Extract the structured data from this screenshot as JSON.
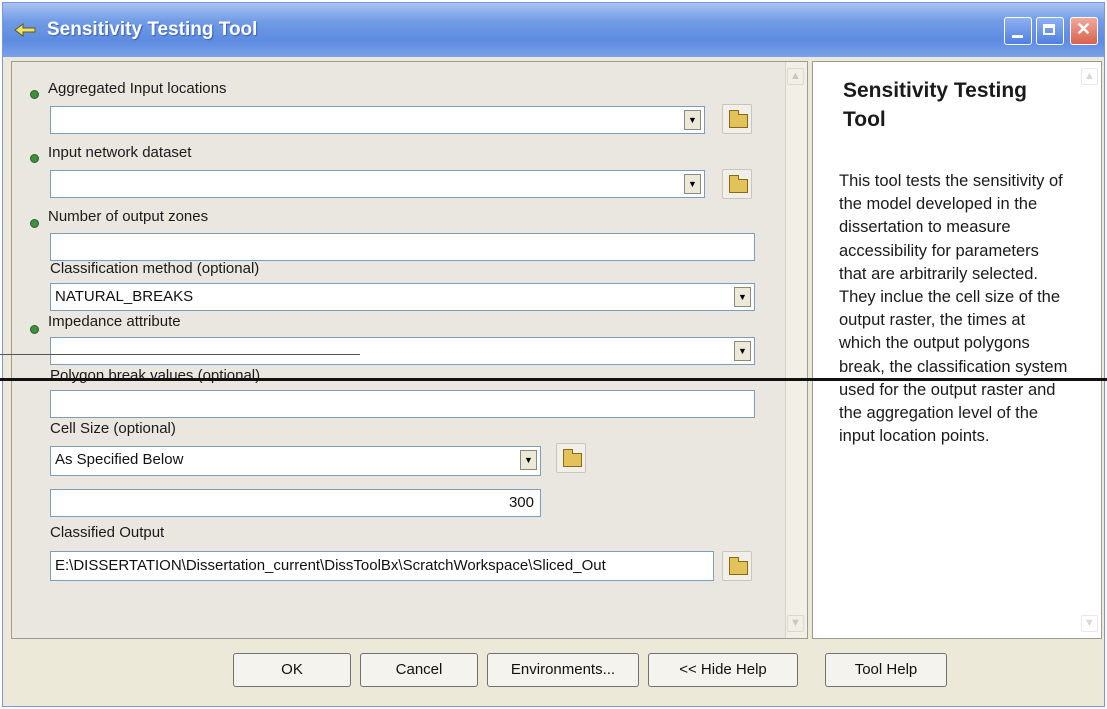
{
  "window": {
    "title": "Sensitivity Testing Tool"
  },
  "form": {
    "aggregated_input_label": "Aggregated Input locations",
    "aggregated_input_value": "",
    "network_label": "Input network dataset",
    "network_value": "",
    "zones_label": "Number of output zones",
    "zones_value": "",
    "classification_label": "Classification method (optional)",
    "classification_value": "NATURAL_BREAKS",
    "impedance_label": "Impedance attribute",
    "impedance_value": "",
    "polygon_label": "Polygon break values (optional)",
    "polygon_value": "",
    "cellsize_label": "Cell Size (optional)",
    "cellsize_value": "As Specified Below",
    "cellsize_number": "300",
    "output_label": "Classified Output",
    "output_value": "E:\\DISSERTATION\\Dissertation_current\\DissToolBx\\ScratchWorkspace\\Sliced_Out"
  },
  "help": {
    "title": "Sensitivity Testing Tool",
    "body": "This tool tests the sensitivity of the model developed in the dissertation to measure accessibility for parameters that are arbitrarily selected. They inclue the cell size of the output raster, the times at which the output polygons break, the classification system used for the output raster and the aggregation level of the input location points."
  },
  "buttons": {
    "ok": "OK",
    "cancel": "Cancel",
    "environments": "Environments...",
    "hide_help": "<< Hide Help",
    "tool_help": "Tool Help"
  },
  "icons": {
    "title": "toolbox-arrow-icon",
    "browse": "open-folder-icon",
    "dropdown": "chevron-down-icon",
    "required": "green-dot-icon"
  }
}
